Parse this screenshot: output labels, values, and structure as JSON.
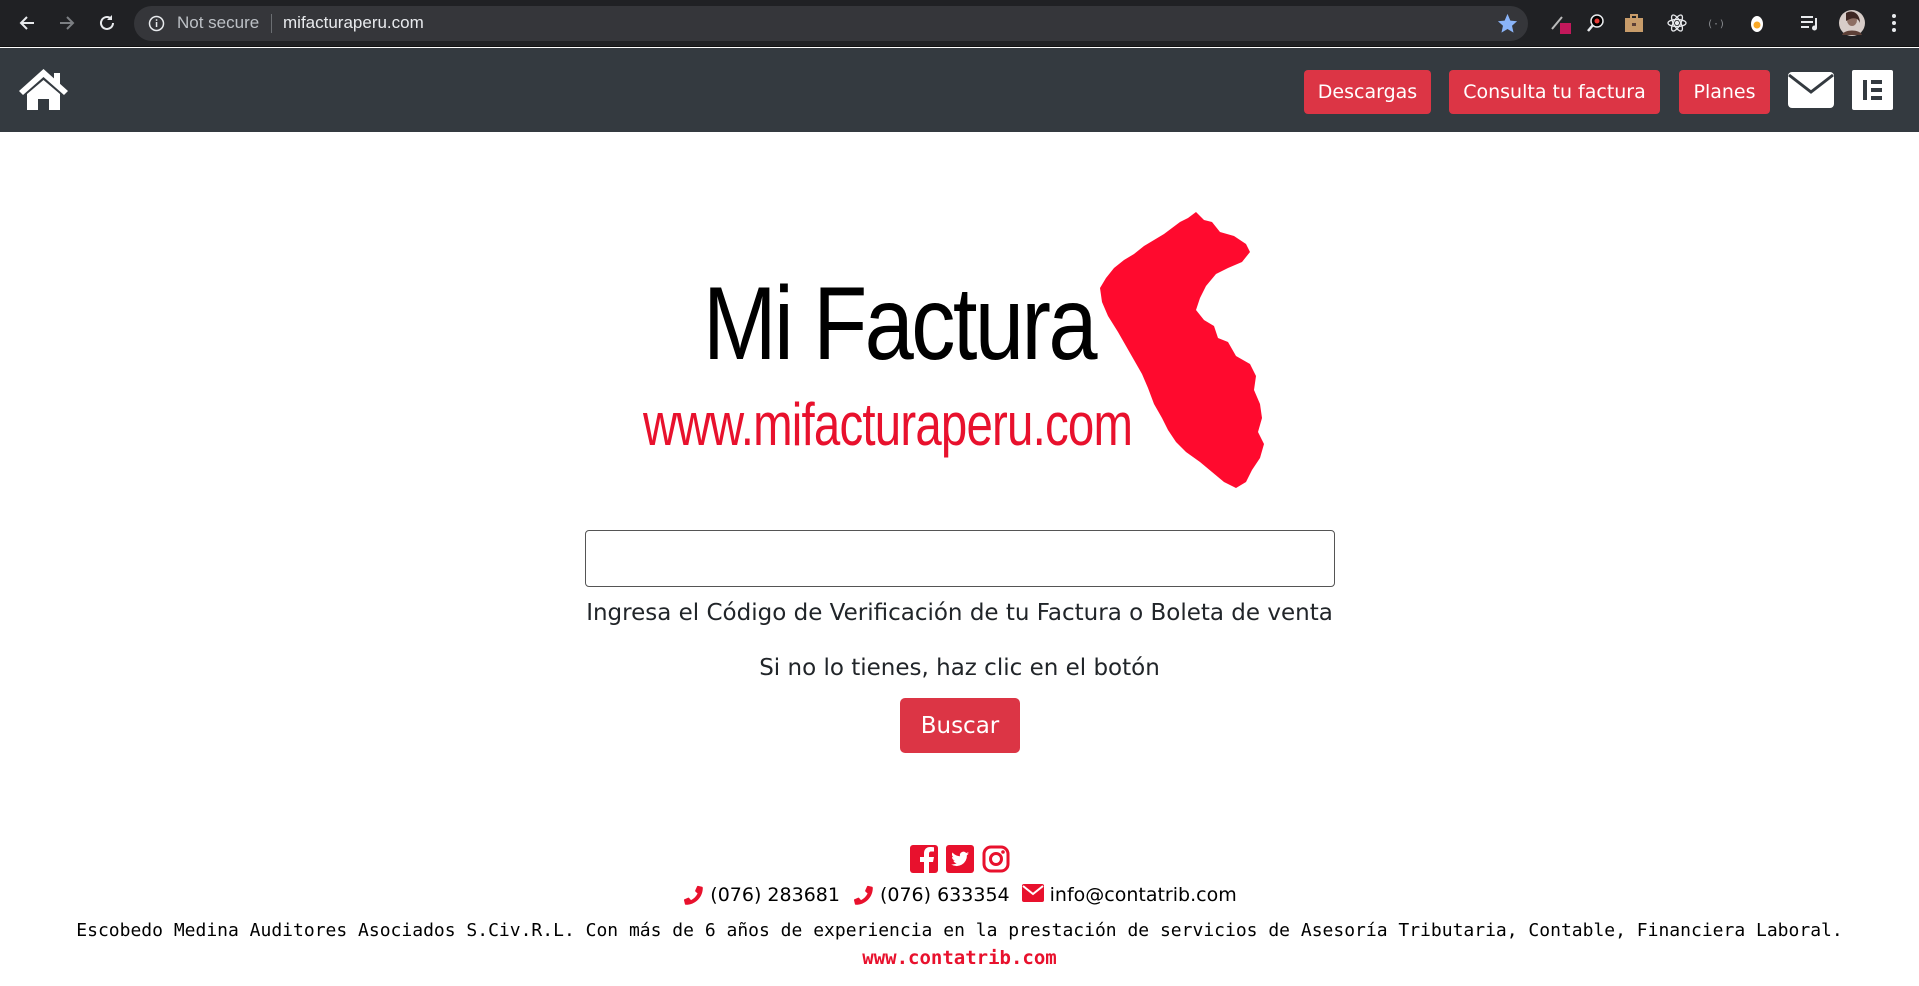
{
  "browser": {
    "security_label": "Not secure",
    "url": "mifacturaperu.com",
    "icons": [
      "back-icon",
      "forward-icon",
      "reload-icon",
      "info-icon",
      "bookmark-star-icon",
      "extension-icons",
      "profile-avatar-icon",
      "kebab-menu-icon"
    ]
  },
  "header": {
    "buttons": [
      {
        "label": "Descargas"
      },
      {
        "label": "Consulta tu factura"
      },
      {
        "label": "Planes"
      }
    ],
    "accent_color": "#dc3545",
    "background_color": "#343a40"
  },
  "logo": {
    "title": "Mi Factura",
    "url_text": "www.mifacturaperu.com",
    "brand_color": "#e8112d"
  },
  "search": {
    "input_value": "",
    "help_text": "Ingresa el Código de Verificación de tu Factura o Boleta de venta",
    "hint_text": "Si no lo tienes, haz clic en el botón",
    "button_label": "Buscar"
  },
  "footer": {
    "social": [
      "facebook-icon",
      "twitter-icon",
      "instagram-icon"
    ],
    "phone_1": "(076) 283681",
    "phone_2": "(076) 633354",
    "email": "info@contatrib.com",
    "company_text": "Escobedo Medina Auditores Asociados S.Civ.R.L. Con más de 6 años de experiencia en la prestación de servicios de Asesoría Tributaria, Contable, Financiera Laboral.",
    "website": "www.contatrib.com"
  }
}
